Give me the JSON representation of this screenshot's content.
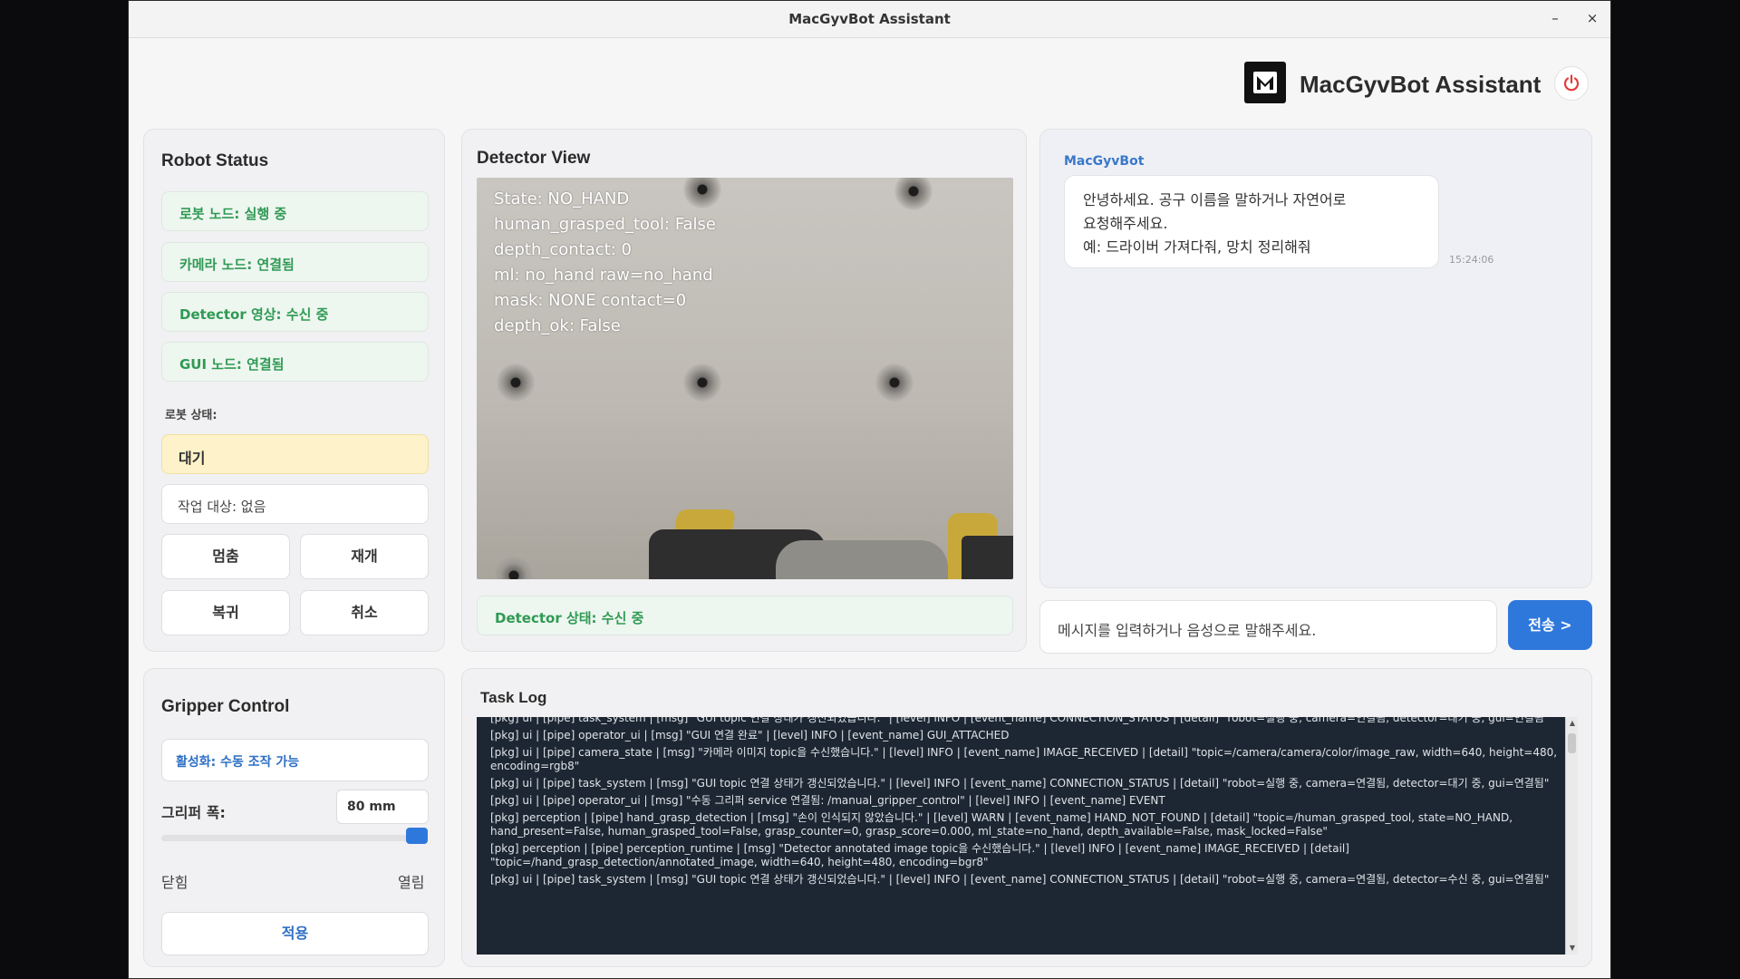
{
  "window": {
    "title": "MacGyvBot Assistant",
    "minimize": "–",
    "close": "×"
  },
  "header": {
    "app_title": "MacGyvBot Assistant",
    "logo_letter": "M",
    "power_icon": "power-icon"
  },
  "robot_status": {
    "title": "Robot Status",
    "nodes": [
      "로봇 노드: 실행 중",
      "카메라 노드: 연결됨",
      "Detector 영상: 수신 중",
      "GUI 노드: 연결됨"
    ],
    "state_label": "로봇 상태:",
    "state_value": "대기",
    "target": "작업 대상: 없음",
    "buttons": {
      "stop": "멈춤",
      "resume": "재개",
      "home": "복귀",
      "cancel": "취소"
    }
  },
  "detector": {
    "title": "Detector View",
    "overlay": [
      "State: NO_HAND",
      "human_grasped_tool: False",
      "depth_contact: 0",
      "ml: no_hand raw=no_hand",
      "mask: NONE contact=0",
      "depth_ok: False"
    ],
    "status": "Detector 상태: 수신 중"
  },
  "chat": {
    "sender": "MacGyvBot",
    "message_lines": [
      "안녕하세요. 공구 이름을 말하거나 자연어로",
      "요청해주세요.",
      "예: 드라이버 가져다줘, 망치 정리해줘"
    ],
    "time": "15:24:06",
    "input_placeholder": "메시지를 입력하거나 음성으로 말해주세요.",
    "send_label": "전송 >"
  },
  "gripper": {
    "title": "Gripper Control",
    "mode": "활성화: 수동 조작 가능",
    "width_label": "그리퍼 폭:",
    "width_value": "80 mm",
    "slider_fraction": 1.0,
    "closed_label": "닫힘",
    "open_label": "열림",
    "apply_label": "적용"
  },
  "task_log": {
    "title": "Task Log",
    "lines": [
      "[pkg] ui | [pipe] task_system | [msg] \"GUI topic 연결 상태가 갱신되었습니다.\" | [level] INFO | [event_name] CONNECTION_STATUS | [detail] \"robot=실행 중, camera=연결됨, detector=대기 중, gui=연결됨\"",
      "[pkg] ui | [pipe] operator_ui | [msg] \"GUI 연결 완료\" | [level] INFO | [event_name] GUI_ATTACHED",
      "[pkg] ui | [pipe] camera_state | [msg] \"카메라 이미지 topic을 수신했습니다.\" | [level] INFO | [event_name] IMAGE_RECEIVED | [detail] \"topic=/camera/camera/color/image_raw, width=640, height=480, encoding=rgb8\"",
      "[pkg] ui | [pipe] task_system | [msg] \"GUI topic 연결 상태가 갱신되었습니다.\" | [level] INFO | [event_name] CONNECTION_STATUS | [detail] \"robot=실행 중, camera=연결됨, detector=대기 중, gui=연결됨\"",
      "[pkg] ui | [pipe] operator_ui | [msg] \"수동 그리퍼 service 연결됨: /manual_gripper_control\" | [level] INFO | [event_name] EVENT",
      "[pkg] perception | [pipe] hand_grasp_detection | [msg] \"손이 인식되지 않았습니다.\" | [level] WARN | [event_name] HAND_NOT_FOUND | [detail] \"topic=/human_grasped_tool, state=NO_HAND, hand_present=False, human_grasped_tool=False, grasp_counter=0, grasp_score=0.000, ml_state=no_hand, depth_available=False, mask_locked=False\"",
      "[pkg] perception | [pipe] perception_runtime | [msg] \"Detector annotated image topic을 수신했습니다.\" | [level] INFO | [event_name] IMAGE_RECEIVED | [detail] \"topic=/hand_grasp_detection/annotated_image, width=640, height=480, encoding=bgr8\"",
      "[pkg] ui | [pipe] task_system | [msg] \"GUI topic 연결 상태가 갱신되었습니다.\" | [level] INFO | [event_name] CONNECTION_STATUS | [detail] \"robot=실행 중, camera=연결됨, detector=수신 중, gui=연결됨\""
    ]
  },
  "colors": {
    "accent": "#2e78dc",
    "status_green": "#2f9a53",
    "state_yellow": "#fdf2c9",
    "log_bg": "#1d2733"
  }
}
